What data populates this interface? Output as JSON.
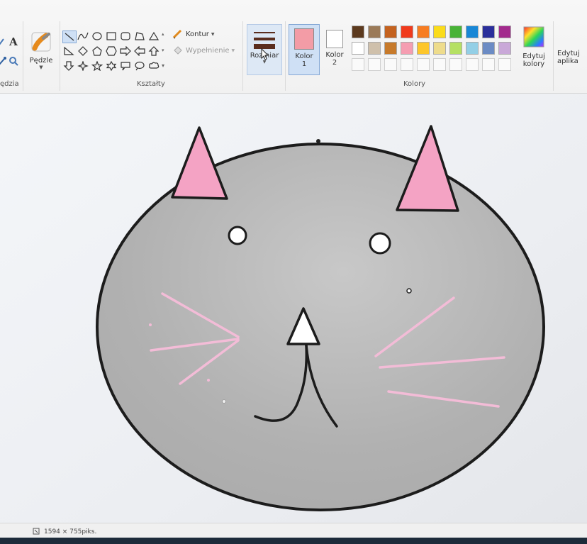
{
  "ribbon": {
    "tools_group_label": "ędzia",
    "text_tool_glyph": "A",
    "brushes_label": "Pędzle",
    "shapes_group_label": "Kształty",
    "outline_label": "Kontur",
    "fill_label": "Wypełnienie",
    "size_label": "Rozmiar",
    "color1_label": "Kolor",
    "color1_number": "1",
    "color2_label": "Kolor",
    "color2_number": "2",
    "colors_group_label": "Kolory",
    "edit_colors_line1": "Edytuj",
    "edit_colors_line2": "kolory",
    "edit_app_line1": "Edytuj",
    "edit_app_line2": "aplika",
    "color1_value": "#f39ca6",
    "color2_value": "#ffffff",
    "palette_row1": [
      "#5c3a1e",
      "#9b7a58",
      "#c4621f",
      "#f03a1c",
      "#f77d22",
      "#fbdc1a",
      "#49b337",
      "#1887d6",
      "#2a2f9b",
      "#a32b8d"
    ],
    "palette_row2": [
      "#ffffff",
      "#cfc0ab",
      "#c77a2b",
      "#f59db1",
      "#fdc62b",
      "#eedc8c",
      "#b5e063",
      "#93cfe6",
      "#6b8bc4",
      "#c9a8d8"
    ]
  },
  "drawing": {
    "head_color": "#b2b2b2",
    "ear_color": "#f4a3c4",
    "whisker_color": "#f3bcd7",
    "outline_color": "#1c1c1c"
  },
  "status": {
    "image_size": "1594 × 755piks."
  }
}
